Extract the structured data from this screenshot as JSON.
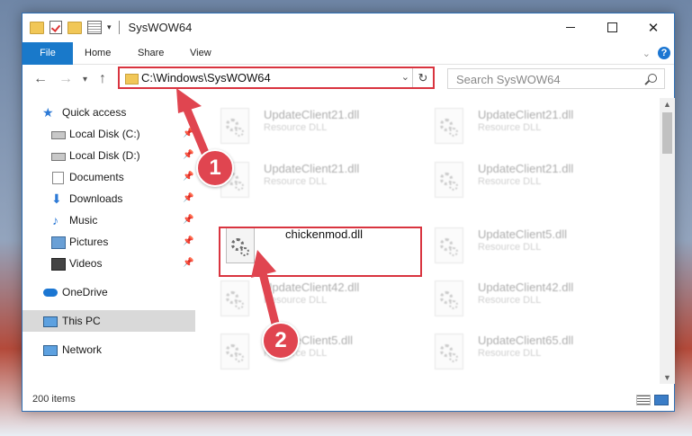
{
  "window": {
    "title": "SysWOW64",
    "controls": {
      "minimize": "",
      "maximize": "",
      "close": "✕"
    }
  },
  "ribbon": {
    "tabs": [
      "File",
      "Home",
      "Share",
      "View"
    ],
    "help": "?"
  },
  "navigation": {
    "back": "←",
    "forward": "→",
    "recent": "▾",
    "up": "↑"
  },
  "address": {
    "path": "C:\\Windows\\SysWOW64",
    "dropdown": "⌄",
    "refresh": "↻"
  },
  "search": {
    "placeholder": "Search SysWOW64"
  },
  "sidebar": {
    "items": [
      {
        "label": "Quick access",
        "icon": "star-icon"
      },
      {
        "label": "Local Disk (C:)",
        "icon": "drive-icon",
        "pinned": true
      },
      {
        "label": "Local Disk (D:)",
        "icon": "drive-icon",
        "pinned": true
      },
      {
        "label": "Documents",
        "icon": "documents-icon",
        "pinned": true
      },
      {
        "label": "Downloads",
        "icon": "downloads-icon",
        "pinned": true
      },
      {
        "label": "Music",
        "icon": "music-icon",
        "pinned": true
      },
      {
        "label": "Pictures",
        "icon": "pictures-icon",
        "pinned": true
      },
      {
        "label": "Videos",
        "icon": "videos-icon",
        "pinned": true
      },
      {
        "label": "OneDrive",
        "icon": "onedrive-icon"
      },
      {
        "label": "This PC",
        "icon": "pc-icon",
        "selected": true
      },
      {
        "label": "Network",
        "icon": "network-icon"
      }
    ]
  },
  "files": [
    {
      "name": "UpdateClient21.dll",
      "type": "Resource DLL"
    },
    {
      "name": "UpdateClient21.dll",
      "type": "Resource DLL"
    },
    {
      "name": "UpdateClient21.dll",
      "type": "Resource DLL"
    },
    {
      "name": "UpdateClient21.dll",
      "type": "Resource DLL"
    },
    {
      "name": "chickenmod.dll",
      "type": ""
    },
    {
      "name": "UpdateClient5.dll",
      "type": "Resource DLL"
    },
    {
      "name": "UpdateClient42.dll",
      "type": "Resource DLL"
    },
    {
      "name": "UpdateClient42.dll",
      "type": "Resource DLL"
    },
    {
      "name": "UpdateClient5.dll",
      "type": "Resource DLL"
    },
    {
      "name": "UpdateClient65.dll",
      "type": "Resource DLL"
    }
  ],
  "status": {
    "item_count": "200 items"
  },
  "callouts": [
    "1",
    "2"
  ],
  "colors": {
    "accent": "#1979ca",
    "highlight": "#d9343f",
    "callout": "#e04550"
  }
}
